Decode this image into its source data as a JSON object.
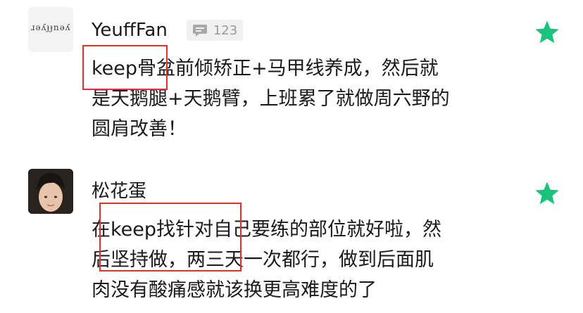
{
  "comments": [
    {
      "username": "YeuffFan",
      "avatar_text": "ɹǝʎɟɟnǝʎ",
      "reply_count": "123",
      "body": [
        "keep骨盆前倾矫正+马甲线养成，然后就",
        "是天鹅腿+天鹅臂，上班累了就做周六野的",
        "圆肩改善！"
      ],
      "star_icon": "star-icon"
    },
    {
      "username": "松花蛋",
      "body": [
        "在keep找针对自己要练的部位就好啦，然",
        "后坚持做，两三天一次都行，做到后面肌",
        "肉没有酸痛感就该换更高难度的了"
      ],
      "star_icon": "star-icon"
    }
  ],
  "colors": {
    "star": "#19c37d",
    "highlight": "#e62e2e",
    "badge_bg": "#f1f1f1",
    "badge_text": "#9a9a9a"
  }
}
